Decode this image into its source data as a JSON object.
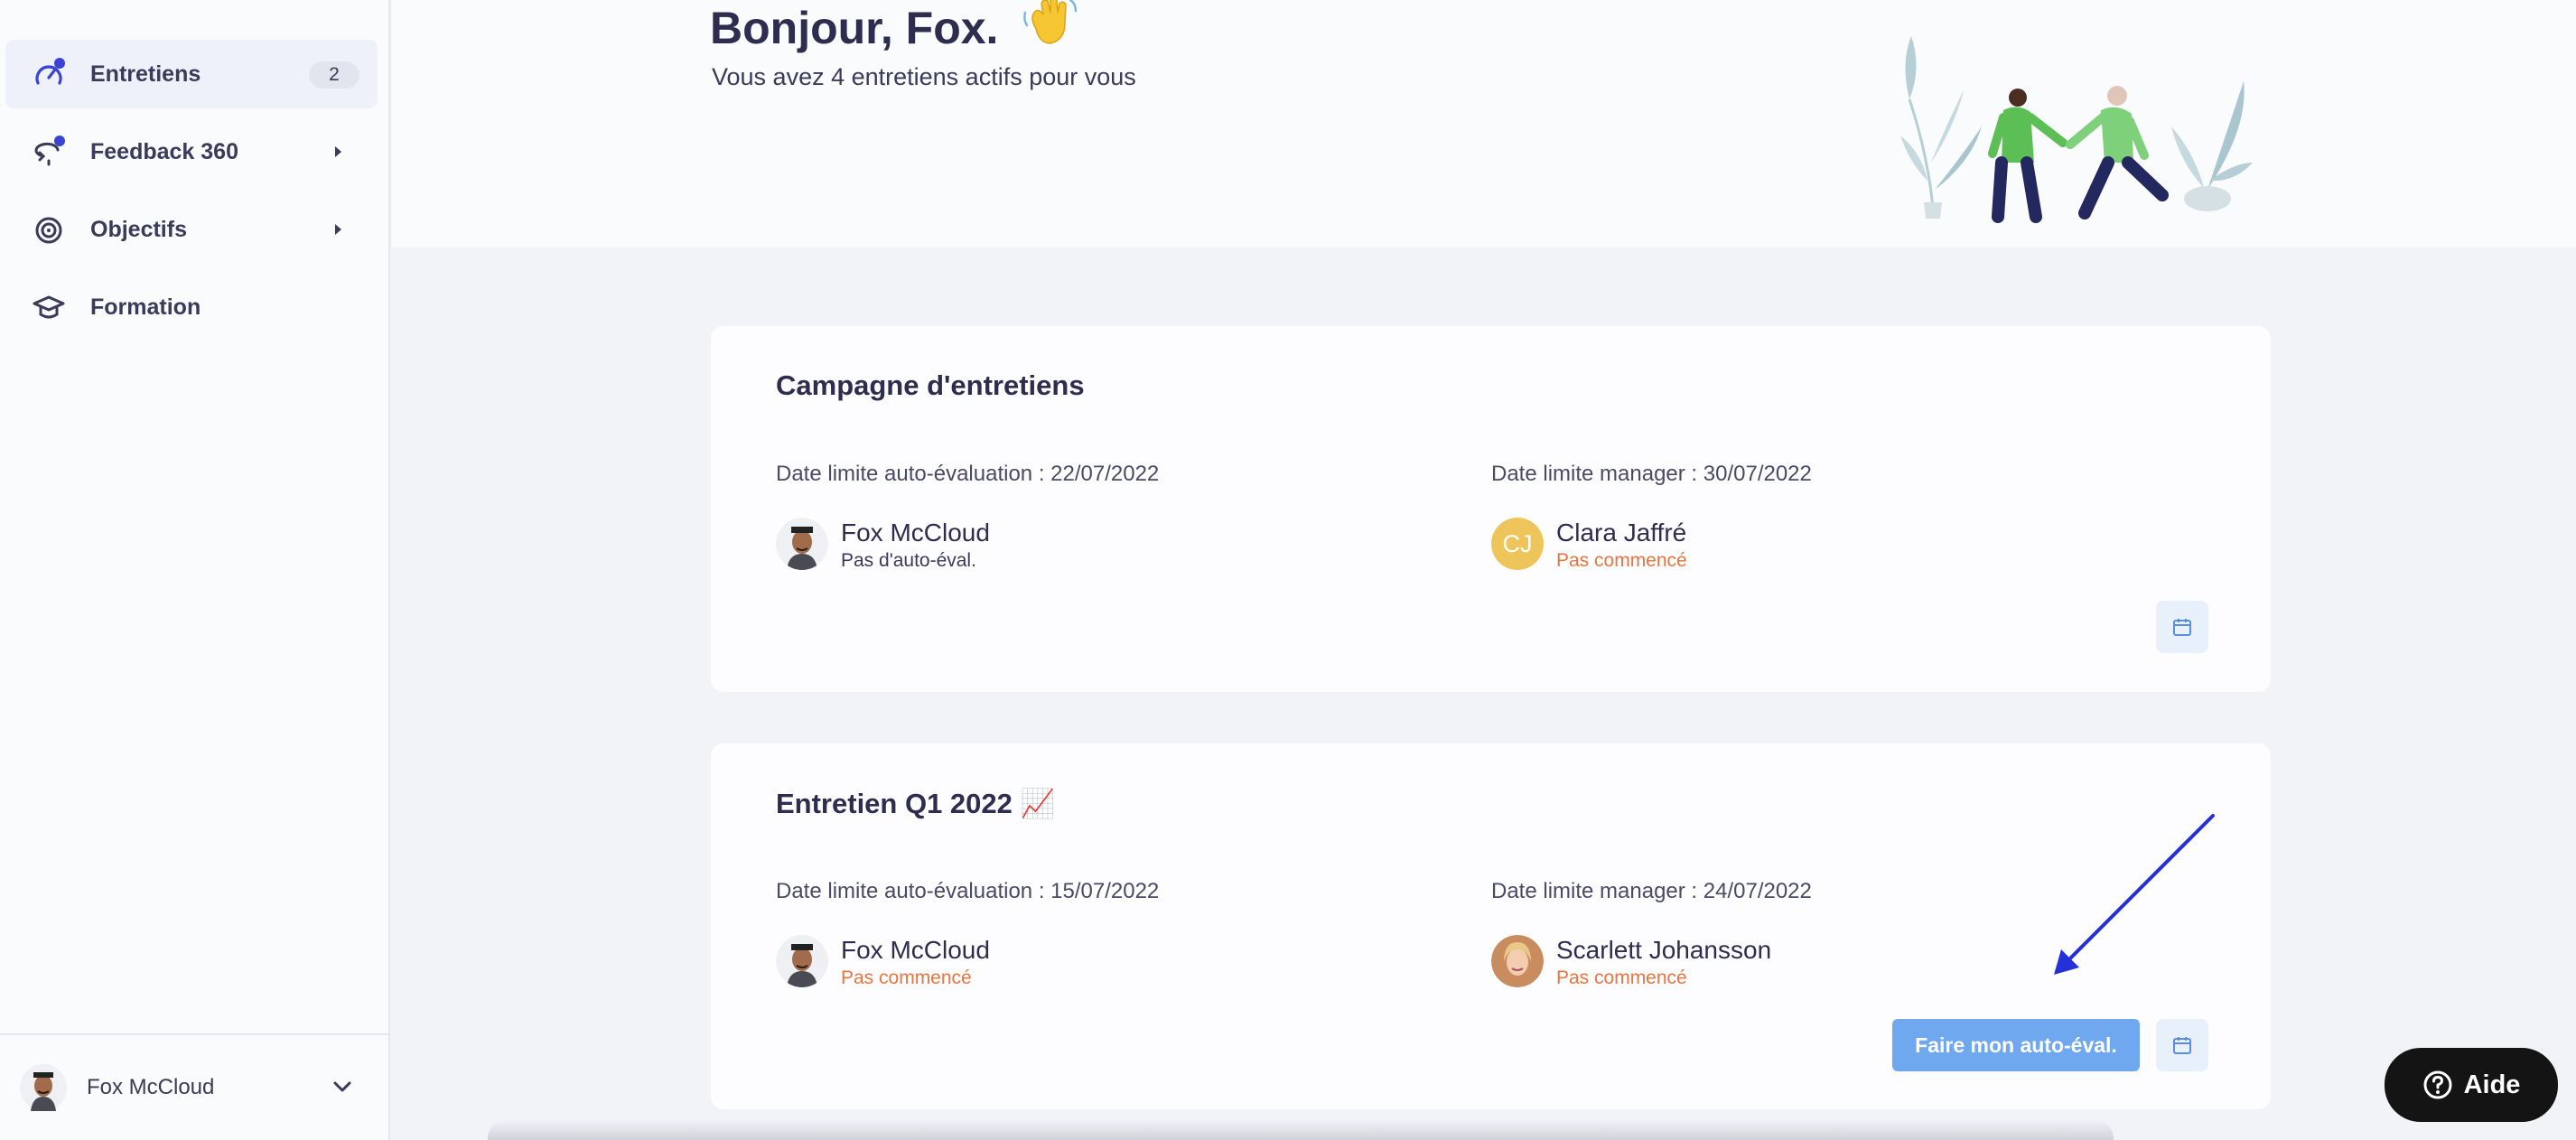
{
  "sidebar": {
    "items": [
      {
        "label": "Entretiens",
        "icon": "gauge-icon",
        "badge": "2",
        "active": true
      },
      {
        "label": "Feedback 360",
        "icon": "feedback-icon"
      },
      {
        "label": "Objectifs",
        "icon": "target-icon"
      },
      {
        "label": "Formation",
        "icon": "graduation-cap-icon"
      }
    ],
    "footer": {
      "name": "Fox McCloud"
    }
  },
  "header": {
    "greeting": "Bonjour, Fox.",
    "subtitle": "Vous avez 4 entretiens actifs pour vous"
  },
  "cards": [
    {
      "title": "Campagne d'entretiens",
      "self_deadline": "Date limite auto-évaluation : 22/07/2022",
      "manager_deadline": "Date limite manager : 30/07/2022",
      "employee": {
        "name": "Fox McCloud",
        "status": "Pas d'auto-éval."
      },
      "manager": {
        "name": "Clara Jaffré",
        "initials": "CJ",
        "status": "Pas commencé"
      }
    },
    {
      "title": "Entretien Q1 2022 📈",
      "self_deadline": "Date limite auto-évaluation : 15/07/2022",
      "manager_deadline": "Date limite manager : 24/07/2022",
      "employee": {
        "name": "Fox McCloud",
        "status": "Pas commencé"
      },
      "manager": {
        "name": "Scarlett Johansson",
        "status": "Pas commencé"
      },
      "action_label": "Faire mon auto-éval."
    }
  ],
  "help": {
    "label": "Aide"
  },
  "colors": {
    "accent": "#3a43d4",
    "status_orange": "#e8753f",
    "primary_button": "#6fa8ef"
  }
}
